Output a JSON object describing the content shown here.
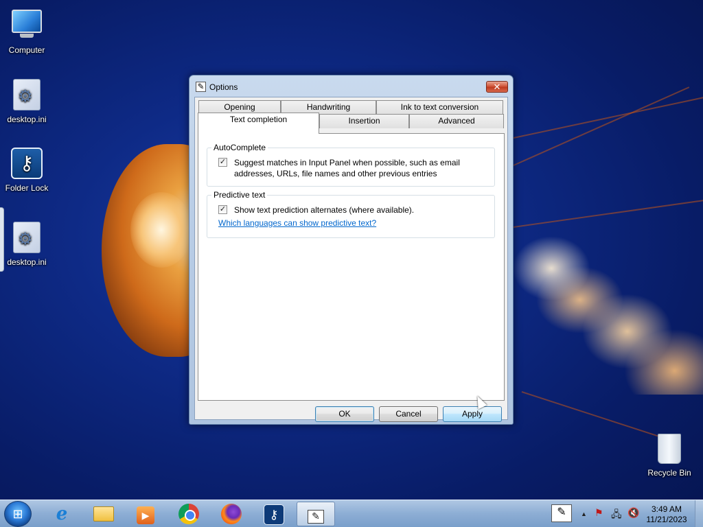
{
  "desktop": {
    "icons": [
      {
        "label": "Computer",
        "icon": "computer-icon"
      },
      {
        "label": "desktop.ini",
        "icon": "settings-file-icon"
      },
      {
        "label": "Folder Lock",
        "icon": "folder-lock-icon"
      },
      {
        "label": "desktop.ini",
        "icon": "settings-file-icon"
      },
      {
        "label": "Recycle Bin",
        "icon": "recycle-bin-icon"
      }
    ]
  },
  "dialog": {
    "title": "Options",
    "close_glyph": "✕",
    "tabs_row1": [
      "Opening",
      "Handwriting",
      "Ink to text conversion"
    ],
    "tabs_row2": [
      "Text completion",
      "Insertion",
      "Advanced"
    ],
    "active_tab": "Text completion",
    "autocomplete": {
      "legend": "AutoComplete",
      "checkbox_label": "Suggest matches in Input Panel when possible, such as email addresses, URLs, file names and other previous entries",
      "checked": true
    },
    "predictive": {
      "legend": "Predictive text",
      "checkbox_label": "Show text prediction alternates (where available).",
      "checked": true,
      "link": "Which languages can show predictive text?"
    },
    "check_glyph": "✓",
    "buttons": {
      "ok": "OK",
      "cancel": "Cancel",
      "apply": "Apply"
    }
  },
  "taskbar": {
    "start_glyph": "⊞",
    "pinned": [
      {
        "name": "Internet Explorer",
        "icon": "internet-explorer-icon",
        "glyph": "e"
      },
      {
        "name": "File Explorer",
        "icon": "file-explorer-icon"
      },
      {
        "name": "Windows Media Player",
        "icon": "media-player-icon",
        "glyph": "▶"
      },
      {
        "name": "Google Chrome",
        "icon": "chrome-icon"
      },
      {
        "name": "Firefox",
        "icon": "firefox-icon"
      },
      {
        "name": "Folder Lock",
        "icon": "folder-lock-icon",
        "glyph": "⚷"
      },
      {
        "name": "Tablet PC Input Panel",
        "icon": "input-panel-icon",
        "glyph": "✎",
        "active": true
      }
    ],
    "tray": {
      "time": "3:49 AM",
      "date": "11/21/2023",
      "show_hidden_glyph": "▲"
    }
  }
}
